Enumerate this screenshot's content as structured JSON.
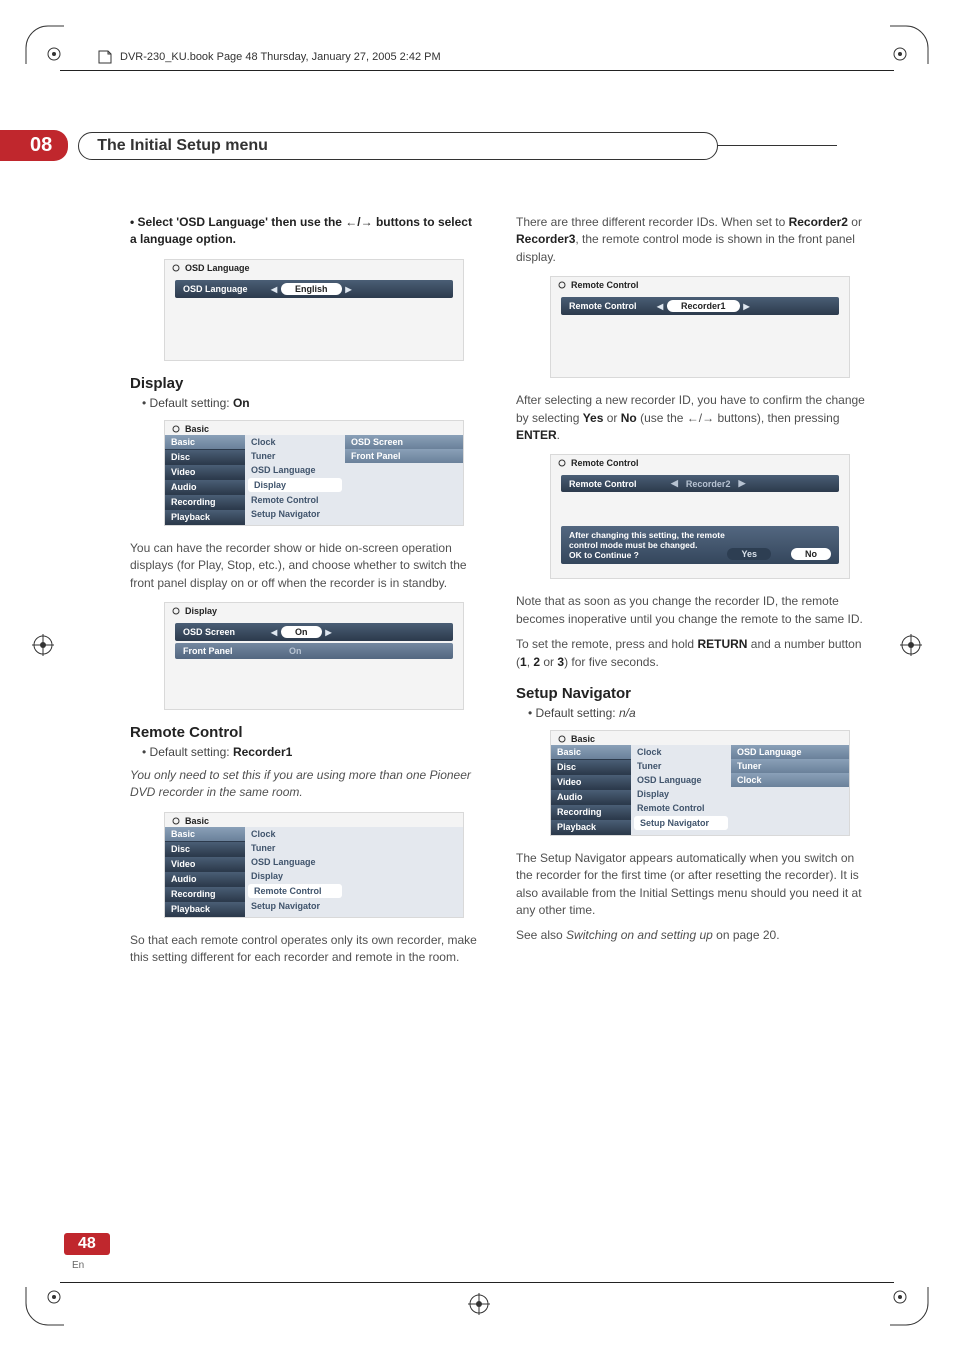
{
  "book_header": "DVR-230_KU.book  Page 48  Thursday, January 27, 2005  2:42 PM",
  "chapter": {
    "number": "08",
    "title": "The Initial Setup menu"
  },
  "left": {
    "instruct1_pre": "•   Select 'OSD Language' then use the ",
    "instruct1_arrows": "←/→",
    "instruct1_post": " buttons to select a language option.",
    "panel_osd": {
      "title": "OSD Language",
      "row_label": "OSD Language",
      "value": "English"
    },
    "h_display": "Display",
    "display_default": "Default setting: ",
    "display_default_val": "On",
    "panel_basic1": {
      "title": "Basic",
      "nav": [
        "Basic",
        "Disc",
        "Video",
        "Audio",
        "Recording",
        "Playback"
      ],
      "mid": [
        "Clock",
        "Tuner",
        "OSD Language",
        "Display",
        "Remote Control",
        "Setup Navigator"
      ],
      "right": [
        "OSD Screen",
        "Front Panel"
      ]
    },
    "display_para": "You can have the recorder show or hide on-screen operation displays (for Play, Stop, etc.), and choose whether to switch the front panel display on or off when the recorder is in standby.",
    "panel_display": {
      "title": "Display",
      "row1_label": "OSD Screen",
      "row1_val": "On",
      "row2_label": "Front Panel",
      "row2_val": "On"
    },
    "h_remote": "Remote Control",
    "remote_default": "Default setting: ",
    "remote_default_val": "Recorder1",
    "remote_italic": "You only need to set this if you are using more than one Pioneer DVD recorder in the same room.",
    "panel_basic2": {
      "title": "Basic",
      "nav": [
        "Basic",
        "Disc",
        "Video",
        "Audio",
        "Recording",
        "Playback"
      ],
      "mid": [
        "Clock",
        "Tuner",
        "OSD Language",
        "Display",
        "Remote Control",
        "Setup Navigator"
      ]
    },
    "remote_para2": "So that each remote control operates only its own recorder, make this setting different for each recorder and remote in the room."
  },
  "right": {
    "para1a": "There are three different recorder IDs. When set to ",
    "para1_rec2": "Recorder2",
    "para1_or": " or ",
    "para1_rec3": "Recorder3",
    "para1b": ", the remote control mode is shown in the front panel display.",
    "panel_rc1": {
      "title": "Remote Control",
      "row_label": "Remote Control",
      "value": "Recorder1"
    },
    "para2a": "After selecting a new recorder ID, you have to confirm the change by selecting ",
    "yes": "Yes",
    "or": " or ",
    "no": "No",
    "para2b": " (use the ",
    "arrows": "←/→",
    "para2c": " buttons), then pressing ",
    "enter": "ENTER",
    "para2d": ".",
    "panel_rc2": {
      "title": "Remote Control",
      "row_label": "Remote Control",
      "value": "Recorder2",
      "confirm_l1": "After changing this setting, the remote",
      "confirm_l2": "control mode must be changed.",
      "confirm_l3": "OK to Continue ?",
      "yes": "Yes",
      "no": "No"
    },
    "para3": "Note that as soon as you change the recorder ID, the remote becomes inoperative until you change the remote to the same ID.",
    "para4a": "To set the remote, press and hold ",
    "return": "RETURN",
    "para4b": " and a number button (",
    "n1": "1",
    "c1": ", ",
    "n2": "2",
    "c2": " or ",
    "n3": "3",
    "para4c": ") for five seconds.",
    "h_setup": "Setup Navigator",
    "setup_default": "Default setting: ",
    "setup_default_val": "n/a",
    "panel_basic3": {
      "title": "Basic",
      "nav": [
        "Basic",
        "Disc",
        "Video",
        "Audio",
        "Recording",
        "Playback"
      ],
      "mid": [
        "Clock",
        "Tuner",
        "OSD Language",
        "Display",
        "Remote Control",
        "Setup Navigator"
      ],
      "right": [
        "OSD Language",
        "Tuner",
        "Clock"
      ]
    },
    "para5": "The Setup Navigator appears automatically when you switch on the recorder for the first time (or after resetting the recorder). It is also available from the Initial Settings menu should you need it at any other time.",
    "para6a": "See also ",
    "para6i": "Switching on and setting up",
    "para6b": " on page 20."
  },
  "page_number": "48",
  "page_lang": "En"
}
